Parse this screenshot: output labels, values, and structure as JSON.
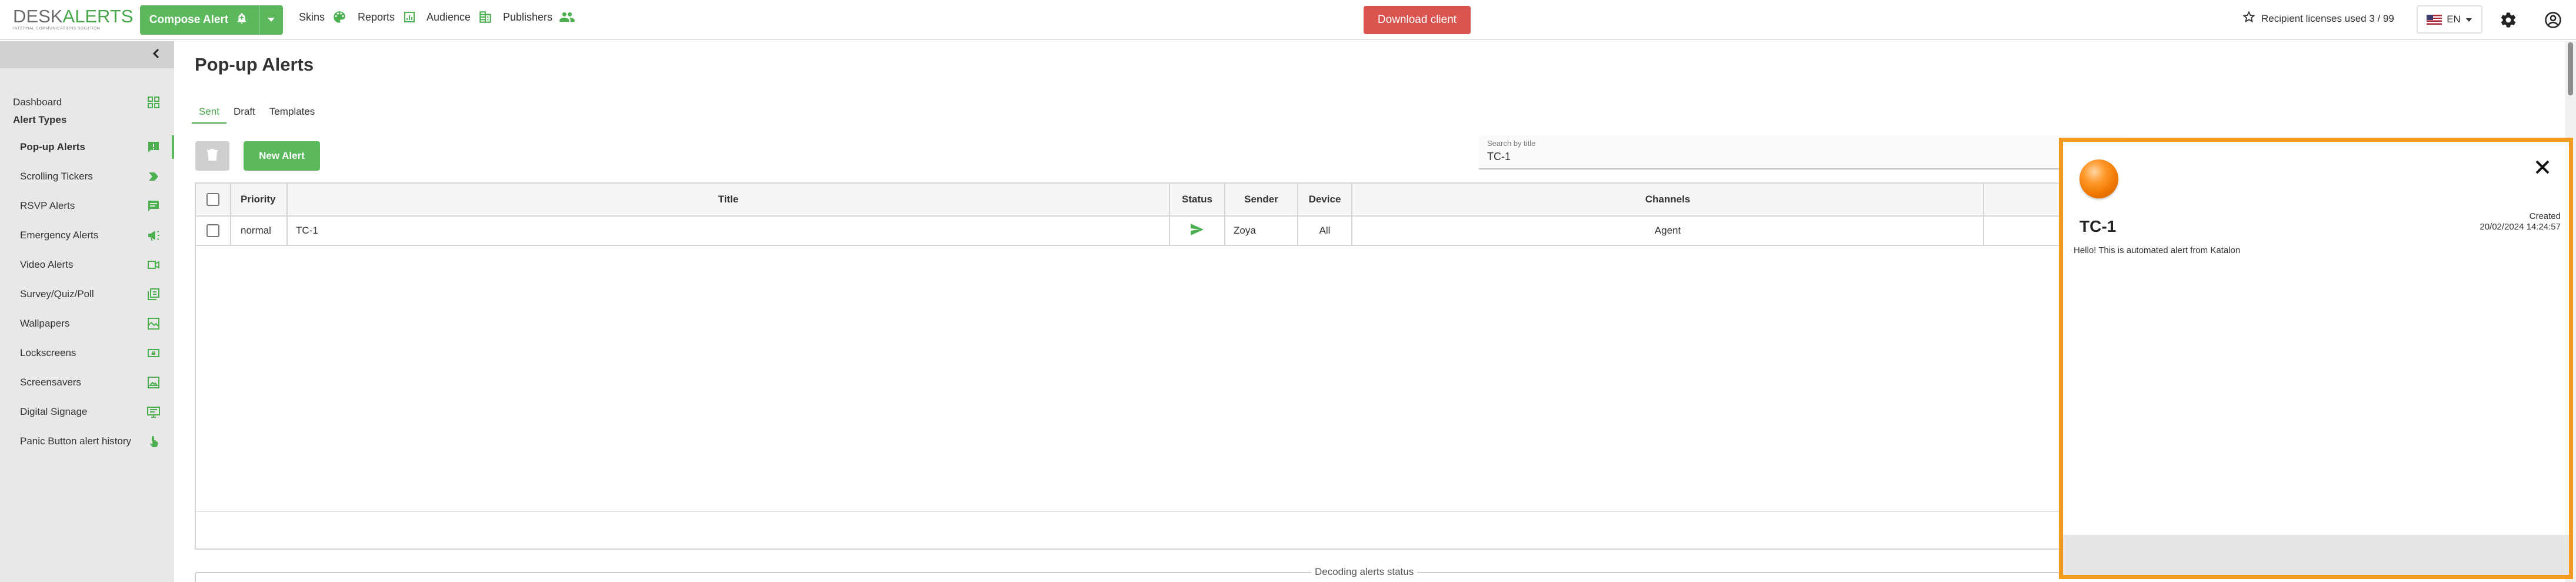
{
  "header": {
    "logo_main_left": "DESK",
    "logo_main_right": "ALERTS",
    "logo_sub": "INTERNAL COMMUNICATIONS SOLUTION",
    "compose_label": "Compose Alert",
    "nav": {
      "skins": "Skins",
      "reports": "Reports",
      "audience": "Audience",
      "publishers": "Publishers"
    },
    "download_label": "Download client",
    "licenses_text": "Recipient licenses used 3 / 99",
    "language": "EN"
  },
  "sidebar": {
    "dashboard": "Dashboard",
    "section_title": "Alert Types",
    "items": [
      {
        "label": "Pop-up Alerts",
        "icon": "popup-alert-icon"
      },
      {
        "label": "Scrolling Tickers",
        "icon": "ticker-icon"
      },
      {
        "label": "RSVP Alerts",
        "icon": "rsvp-icon"
      },
      {
        "label": "Emergency Alerts",
        "icon": "megaphone-icon"
      },
      {
        "label": "Video Alerts",
        "icon": "video-icon"
      },
      {
        "label": "Survey/Quiz/Poll",
        "icon": "survey-icon"
      },
      {
        "label": "Wallpapers",
        "icon": "wallpaper-icon"
      },
      {
        "label": "Lockscreens",
        "icon": "lockscreen-icon"
      },
      {
        "label": "Screensavers",
        "icon": "screensaver-icon"
      },
      {
        "label": "Digital Signage",
        "icon": "signage-icon"
      },
      {
        "label": "Panic Button alert history",
        "icon": "panic-hand-icon"
      }
    ]
  },
  "main": {
    "title": "Pop-up Alerts",
    "tabs": [
      "Sent",
      "Draft",
      "Templates"
    ],
    "new_alert_label": "New Alert",
    "search": {
      "label": "Search by title",
      "value": "TC-1"
    },
    "table": {
      "headers": {
        "priority": "Priority",
        "title": "Title",
        "status": "Status",
        "sender": "Sender",
        "device": "Device",
        "channels": "Channels"
      },
      "rows": [
        {
          "priority": "normal",
          "title": "TC-1",
          "status_icon": "sent-icon",
          "sender": "Zoya",
          "device": "All",
          "channels": "Agent"
        }
      ]
    },
    "decoding_label": "Decoding alerts status"
  },
  "popup": {
    "title": "TC-1",
    "created_label": "Created",
    "created_value": "20/02/2024 14:24:57",
    "body": "Hello! This is automated alert from Katalon"
  },
  "colors": {
    "brand_green": "#5cb85c",
    "download_red": "#d9534f",
    "popup_border": "#f49b1c"
  }
}
